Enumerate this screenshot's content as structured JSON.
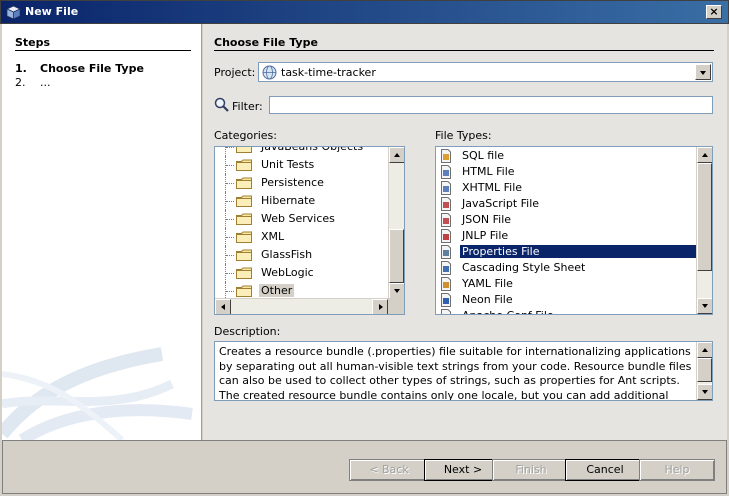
{
  "window": {
    "title": "New File",
    "close_label": "×"
  },
  "steps": {
    "heading": "Steps",
    "items": [
      {
        "num": "1.",
        "label": "Choose File Type"
      },
      {
        "num": "2.",
        "label": "..."
      }
    ]
  },
  "main": {
    "title": "Choose File Type",
    "project_label": "Project:",
    "project_value": "task-time-tracker",
    "filter_label": "Filter:",
    "filter_value": "",
    "categories_label": "Categories:",
    "file_types_label": "File Types:",
    "description_label": "Description:",
    "description_text": "Creates a resource bundle (.properties) file suitable for internationalizing applications by separating out all human-visible text strings from your code. Resource bundle files can also be used to collect other types of strings, such as properties for Ant scripts. The created resource bundle contains only one locale, but you can add additional locales from the created file's"
  },
  "categories": [
    "JavaBeans Objects",
    "Unit Tests",
    "Persistence",
    "Hibernate",
    "Web Services",
    "XML",
    "GlassFish",
    "WebLogic",
    "Other"
  ],
  "selected_category": "Other",
  "file_types": [
    {
      "label": "SQL file",
      "icon": "sql-file-icon"
    },
    {
      "label": "HTML File",
      "icon": "html-file-icon"
    },
    {
      "label": "XHTML File",
      "icon": "xhtml-file-icon"
    },
    {
      "label": "JavaScript File",
      "icon": "javascript-file-icon"
    },
    {
      "label": "JSON File",
      "icon": "json-file-icon"
    },
    {
      "label": "JNLP File",
      "icon": "jnlp-file-icon"
    },
    {
      "label": "Properties File",
      "icon": "properties-file-icon"
    },
    {
      "label": "Cascading Style Sheet",
      "icon": "css-file-icon"
    },
    {
      "label": "YAML File",
      "icon": "yaml-file-icon"
    },
    {
      "label": "Neon File",
      "icon": "neon-file-icon"
    },
    {
      "label": "Apache Conf File",
      "icon": "apache-conf-file-icon"
    }
  ],
  "selected_file_type": "Properties File",
  "buttons": {
    "back": "< Back",
    "next": "Next >",
    "finish": "Finish",
    "cancel": "Cancel",
    "help": "Help"
  },
  "colors": {
    "selection": "#0a246a",
    "title_bar": "#0a246a"
  }
}
